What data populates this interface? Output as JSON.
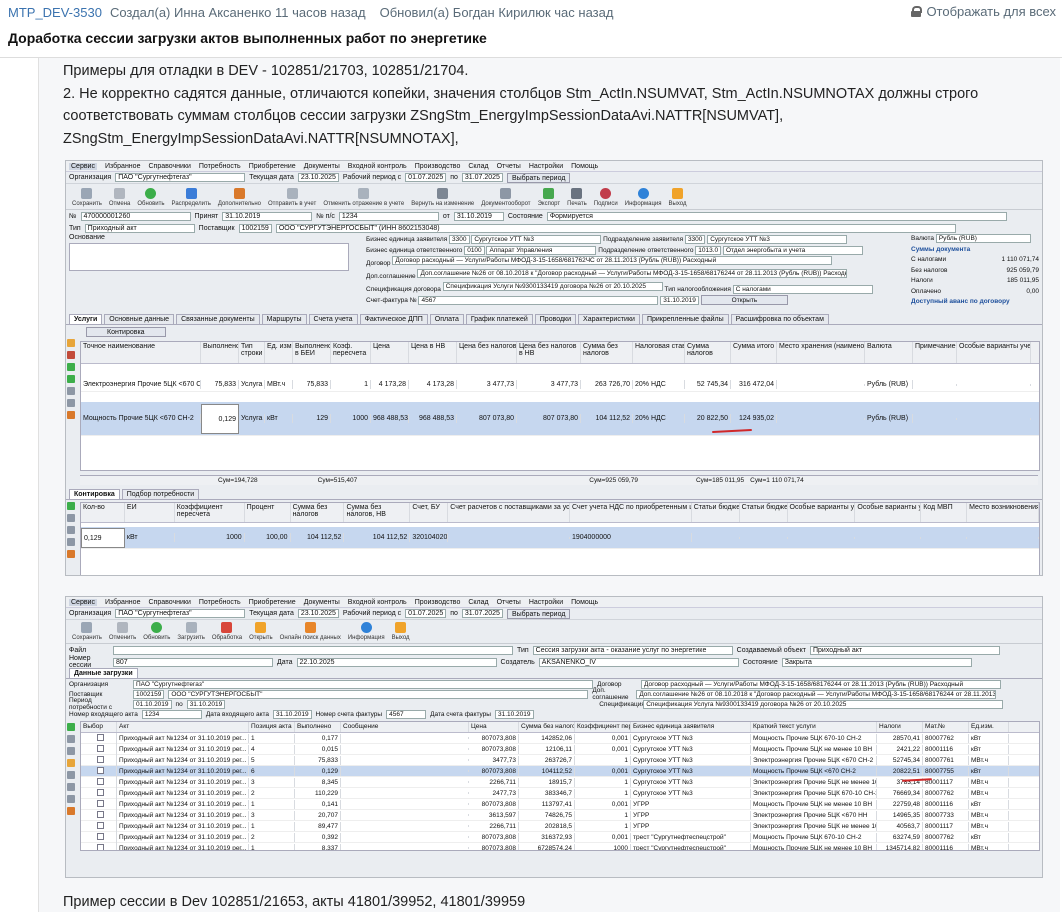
{
  "issue": {
    "key": "MTP_DEV-3530",
    "created": "Создал(а) Инна Аксаненко 11 часов назад",
    "updated": "Обновил(а) Богдан Кирилюк час назад",
    "display_toggle": "Отображать для всех",
    "title": "Доработка сессии загрузки актов выполненных работ по энергетике"
  },
  "body": {
    "line1": "Примеры для отладки в DEV -  102851/21703, 102851/21704.",
    "line2": "2. Не корректно садятся данные, отличаются копейки, значения столбцов Stm_ActIn.NSUMVAT, Stm_ActIn.NSUMNOTAX должны строго",
    "line3": "соответствовать суммам столбцов сессии загрузки ZSngStm_EnergyImpSessionDataAvi.NATTR[NSUMVAT],",
    "line4": "ZSngStm_EnergyImpSessionDataAvi.NATTR[NSUMNOTAX],",
    "footer": "Пример сессии в Dev 102851/21653, акты 41801/39952, 41801/39959"
  },
  "shot1": {
    "menu": [
      "Сервис",
      "Избранное",
      "Справочники",
      "Потребность",
      "Приобретение",
      "Документы",
      "Входной контроль",
      "Производство",
      "Склад",
      "Отчеты",
      "Настройки",
      "Помощь"
    ],
    "org_label": "Организация",
    "org_value": "ПАО \"Сургутнефтегаз\"",
    "date_label": "Текущая дата",
    "date_value": "23.10.2025",
    "period_label": "Рабочий период с",
    "period_from": "01.07.2025",
    "period_to": "31.07.2025",
    "period_btn": "Выбрать период",
    "toolbar": [
      "Сохранить",
      "Отмена",
      "Обновить",
      "Распределить",
      "Дополнительно",
      "Отправить в учет",
      "Отменить отражение в учете",
      "Вернуть на изменение",
      "Документооборот",
      "Экспорт",
      "Печать",
      "Подписи",
      "Информация",
      "Выход"
    ],
    "fields": {
      "num_label": "№",
      "num_value": "470000001260",
      "accepted_label": "Принят",
      "accepted_value": "31.10.2019",
      "np_label": "№ п/с",
      "np_value": "1234",
      "from_label": "от",
      "from_value": "31.10.2019",
      "state_label": "Состояние",
      "state_value": "Формируется",
      "type_label": "Тип",
      "type_value": "Приходный акт",
      "supplier_label": "Поставщик",
      "supplier_code": "1002159",
      "supplier_value": "ООО \"СУРГУТЭНЕРГОСБЫТ\" (ИНН 8602153048)",
      "basis_label": "Основание",
      "be_label": "Бизнес единица заявителя",
      "be_code": "3300",
      "be_value": "Сургутское УТТ №3",
      "bo_label": "Бизнес единица ответственного",
      "bo_code": "0100",
      "bo_value": "Аппарат Управления",
      "dept_label": "Подразделение заявителя",
      "dept_code": "3300",
      "dept_value": "Сургутское УТТ №3",
      "dept2_label": "Подразделение ответственного",
      "dept2_code": "1013.0",
      "dept2_value": "Отдел энергобыта и учета",
      "contract_label": "Договор",
      "contract_value": "Договор расходный — Услуги/Работы МФОД-3-15-1658/681762ЧС от 28.11.2013 (Рубль (RUB)) Расходный",
      "addagr_label": "Доп.соглашение",
      "addagr_value": "Доп.соглашение №26 от 08.10.2018 к \"Договор расходный — Услуги/Работы МФОД-3-15-1658/68176244 от 28.11.2013 (Рубль (RUB)) Расходный\"",
      "spec_label": "Спецификация договора",
      "spec_value": "Спецификация Услуги №9300133419 договора №26 от 20.10.2025",
      "tax_label": "Тип налогообложения",
      "tax_value": "С налогами",
      "invoice_label": "Счет-фактура №",
      "invoice_value": "4567",
      "invoice_date": "31.10.2019",
      "open_btn": "Открыть",
      "currency_label": "Валюта",
      "currency_value": "Рубль (RUB)"
    },
    "sums": {
      "title": "Суммы документа",
      "with_tax_label": "С налогами",
      "with_tax": "1 110 071,74",
      "no_tax_label": "Без налогов",
      "no_tax": "925 059,79",
      "tax_label": "Налоги",
      "tax": "185 011,95",
      "paid_label": "Оплачено",
      "paid": "0,00",
      "avail": "Доступный аванс по договору"
    },
    "tabs": [
      "Услуги",
      "Основные данные",
      "Связанные документы",
      "Маршруты",
      "Счета учета",
      "Фактическое ДПП",
      "Оплата",
      "График платежей",
      "Проводки",
      "Характеристики",
      "Прикрепленные файлы",
      "Расшифровка по объектам"
    ],
    "control_btn": "Контировка",
    "columns": [
      "Точное наименование",
      "Выполнено",
      "Тип строки",
      "Ед. изм.",
      "Выполнено в БЕИ",
      "Коэф. пересчета",
      "Цена",
      "Цена в НВ",
      "Цена без налогов",
      "Цена без налогов в НВ",
      "Сумма без налогов",
      "Налоговая ставка",
      "Сумма налогов",
      "Сумма итого",
      "Место хранения (наименование)",
      "Валюта",
      "Примечание",
      "Особые варианты учета"
    ],
    "rows": [
      [
        "Электроэнергия Прочие 5ЦК <670 СН-2",
        "75,833",
        "Услуга",
        "МВт.ч",
        "75,833",
        "1",
        "4 173,28",
        "4 173,28",
        "3 477,73",
        "3 477,73",
        "263 726,70",
        "20% НДС",
        "52 745,34",
        "316 472,04",
        "",
        "Рубль (RUB)",
        "",
        ""
      ],
      [
        "Мощность Прочие 5ЦК <670 СН-2",
        "0,129",
        "Услуга",
        "кВт",
        "129",
        "1000",
        "968 488,53",
        "968 488,53",
        "807 073,80",
        "807 073,80",
        "104 112,52",
        "20% НДС",
        "20 822,50",
        "124 935,02",
        "",
        "Рубль (RUB)",
        "",
        ""
      ]
    ],
    "sum_line": [
      "Сум=194,728",
      "Сум=515,407",
      "Сум=925 059,79",
      "Сум=185 011,95",
      "Сум=1 110 071,74"
    ],
    "tabs2": [
      "Контировка",
      "Подбор потребности"
    ],
    "columns2": [
      "Кол-во",
      "ЕИ",
      "Коэффициент пересчета",
      "Процент",
      "Сумма без налогов",
      "Сумма без налогов, НВ",
      "Счет, БУ",
      "Счет расчетов с поставщиками за услуги",
      "Счет учета НДС по приобретенным ценностям",
      "Статьи бюджета",
      "Статьи бюджета",
      "Особые варианты учета",
      "Особые варианты учета",
      "Код МВП",
      "Место возникновения затрат"
    ],
    "row2": [
      "0,129",
      "кВт",
      "1000",
      "100,00",
      "104 112,52",
      "104 112,52",
      "3201040200",
      "",
      "1904000000",
      "",
      "",
      "",
      "",
      "",
      ""
    ]
  },
  "shot2": {
    "menu": [
      "Сервис",
      "Избранное",
      "Справочники",
      "Потребность",
      "Приобретение",
      "Документы",
      "Входной контроль",
      "Производство",
      "Склад",
      "Отчеты",
      "Настройки",
      "Помощь"
    ],
    "org_label": "Организация",
    "org_value": "ПАО \"Сургутнефтегаз\"",
    "date_label": "Текущая дата",
    "date_value": "23.10.2025",
    "period_label": "Рабочий период с",
    "period_from": "01.07.2025",
    "period_to": "31.07.2025",
    "period_btn": "Выбрать период",
    "toolbar": [
      "Сохранить",
      "Отменить",
      "Обновить",
      "Загрузить",
      "Обработка",
      "Открыть",
      "Онлайн поиск данных",
      "Информация",
      "Выход"
    ],
    "file_label": "Файл",
    "type_label": "Тип",
    "type_value": "Сессия загрузки акта - оказание услуг по энергетике",
    "created_obj_label": "Создаваемый объект",
    "created_obj_value": "Приходный акт",
    "session_label": "Номер сессии",
    "session_value": "807",
    "date2_label": "Дата",
    "date2_value": "22.10.2025",
    "creator_label": "Создатель",
    "creator_value": "AKSANENKO_IV",
    "state_label": "Состояние",
    "state_value": "Закрыта",
    "tab": "Данные загрузки",
    "org2_label": "Организация",
    "org2_value": "ПАО \"Сургутнефтегаз\"",
    "supp_label": "Поставщик",
    "supp_code": "1002159",
    "supp_value": "ООО \"СУРГУТЭНЕРГОСБЫТ\"",
    "period2_label": "Период потребности с",
    "period2_from": "01.10.2019",
    "period2_to": "31.10.2019",
    "inact_label": "Номер входящего акта",
    "inact_value": "1234",
    "actdate_label": "Дата входящего акта",
    "actdate_value": "31.10.2019",
    "invnum_label": "Номер счета фактуры",
    "invnum_value": "4567",
    "invdate_label": "Дата счета фактуры",
    "invdate_value": "31.10.2019",
    "contract_label": "Договор",
    "contract_value": "Договор расходный — Услуги/Работы МФОД-3-15-1658/68176244 от 28.11.2013 (Рубль (RUB)) Расходный",
    "addagr_label": "Доп. соглашение",
    "addagr_value": "Доп.соглашение №26 от 08.10.2018 к \"Договор расходный — Услуги/Работы МФОД-3-15-1658/68176244 от 28.11.2013 (Рубль (RUB)) Расходный\"",
    "spec_label": "Спецификация",
    "spec_value": "Спецификация Услуга №9300133419 договора №26 от 20.10.2025",
    "columns": [
      "Выбор",
      "Акт",
      "Позиция акта",
      "Выполнено",
      "Сообщение",
      "Цена",
      "Сумма без налогов",
      "Коэффициент пересч...",
      "Бизнес единица заявителя",
      "Краткий текст услуги",
      "Налоги",
      "Мат.№",
      "Ед.изм."
    ],
    "rows": [
      [
        "",
        "Приходный акт №1234 от 31.10.2019 рег...",
        "1",
        "0,177",
        "",
        "807073,808",
        "142852,06",
        "0,001",
        "Сургутское УТТ №3",
        "Мощность Прочие 5ЦК 670-10 СН-2",
        "28570,41",
        "80007762",
        "кВт"
      ],
      [
        "",
        "Приходный акт №1234 от 31.10.2019 рег...",
        "4",
        "0,015",
        "",
        "807073,808",
        "12106,11",
        "0,001",
        "Сургутское УТТ №3",
        "Мощность Прочие 5ЦК не менее 10 ВН",
        "2421,22",
        "80001116",
        "кВт"
      ],
      [
        "",
        "Приходный акт №1234 от 31.10.2019 рег...",
        "5",
        "75,833",
        "",
        "3477,73",
        "263726,7",
        "1",
        "Сургутское УТТ №3",
        "Электроэнергия Прочие 5ЦК <670 СН-2",
        "52745,34",
        "80007761",
        "МВт.ч"
      ],
      [
        "",
        "Приходный акт №1234 от 31.10.2019 рег...",
        "6",
        "0,129",
        "",
        "807073,808",
        "104112,52",
        "0,001",
        "Сургутское УТТ №3",
        "Мощность Прочие 5ЦК <670 СН-2",
        "20822,51",
        "80007755",
        "кВт"
      ],
      [
        "",
        "Приходный акт №1234 от 31.10.2019 рег...",
        "3",
        "8,345",
        "",
        "2266,711",
        "18915,7",
        "1",
        "Сургутское УТТ №3",
        "Электроэнергия Прочие 5ЦК не менее 10 ВН",
        "3783,14",
        "80001117",
        "МВт.ч"
      ],
      [
        "",
        "Приходный акт №1234 от 31.10.2019 рег...",
        "2",
        "110,229",
        "",
        "2477,73",
        "383346,7",
        "1",
        "Сургутское УТТ №3",
        "Электроэнергия Прочие 5ЦК 670-10 СН-2",
        "76669,34",
        "80007762",
        "МВт.ч"
      ],
      [
        "",
        "Приходный акт №1234 от 31.10.2019 рег...",
        "1",
        "0,141",
        "",
        "807073,808",
        "113797,41",
        "0,001",
        "УГРР",
        "Мощность Прочие 5ЦК не менее 10 ВН",
        "22759,48",
        "80001116",
        "кВт"
      ],
      [
        "",
        "Приходный акт №1234 от 31.10.2019 рег...",
        "3",
        "20,707",
        "",
        "3613,597",
        "74826,75",
        "1",
        "УГРР",
        "Электроэнергия Прочие 5ЦК <670 НН",
        "14965,35",
        "80007733",
        "МВт.ч"
      ],
      [
        "",
        "Приходный акт №1234 от 31.10.2019 рег...",
        "1",
        "89,477",
        "",
        "2266,711",
        "202818,5",
        "1",
        "УГРР",
        "Электроэнергия Прочие 5ЦК не менее 10 ВН",
        "40563,7",
        "80001117",
        "МВт.ч"
      ],
      [
        "",
        "Приходный акт №1234 от 31.10.2019 рег...",
        "2",
        "0,392",
        "",
        "807073,808",
        "316372,93",
        "0,001",
        "трест \"Сургутнефтеспецстрой\"",
        "Мощность Прочие 5ЦК 670-10 СН-2",
        "63274,59",
        "80007762",
        "кВт"
      ],
      [
        "",
        "Приходный акт №1234 от 31.10.2019 рег...",
        "1",
        "8,337",
        "",
        "807073,808",
        "6728574,24",
        "1000",
        "трест \"Сургутнефтеспецстрой\"",
        "Мощность Прочие 5ЦК не менее 10 ВН",
        "1345714,82",
        "80001116",
        "МВт.ч"
      ]
    ]
  }
}
